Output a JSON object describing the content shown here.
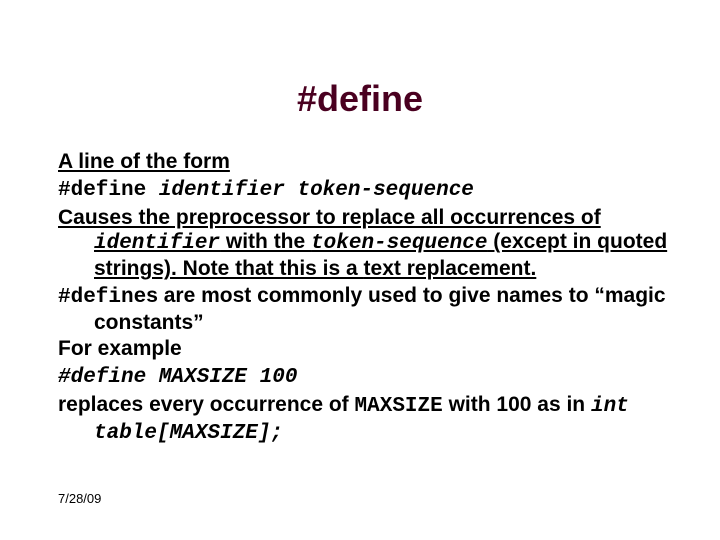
{
  "title": "#define",
  "body": {
    "p1": "A line of the form",
    "p1code_pre": "#define ",
    "p1code_ident": "identifier",
    "p1code_sep": " ",
    "p1code_tok": "token-sequence",
    "p2a": "Causes the preprocessor to replace all occurrences of ",
    "p2_ident": "identifier",
    "p2b": " with the ",
    "p2_tok": "token-sequence",
    "p2c": " (except in quoted strings).  Note that this is a ",
    "p2d_u": "text replacement.",
    "p3a_mono": "#define",
    "p3a_s": "s",
    "p3b": " are most commonly used to give names to “magic constants”",
    "p4": "For example",
    "p4code": "#define MAXSIZE 100",
    "p5a": "replaces every occurrence of ",
    "p5_max": "MAXSIZE",
    "p5b": " with 100 as in ",
    "p5code": "int table[MAXSIZE];"
  },
  "date": "7/28/09"
}
